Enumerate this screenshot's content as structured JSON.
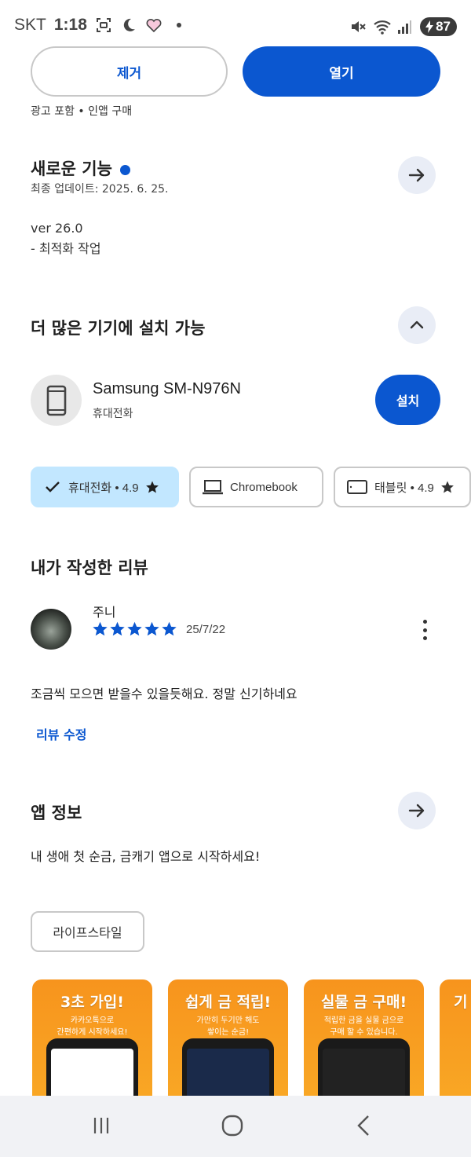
{
  "status_bar": {
    "carrier": "SKT",
    "time": "1:18",
    "battery": "87"
  },
  "actions": {
    "remove_label": "제거",
    "open_label": "열기"
  },
  "ads_note": "광고 포함 • 인앱 구매",
  "whats_new": {
    "title": "새로운 기능",
    "updated": "최종 업데이트: 2025. 6. 25.",
    "version": "ver 26.0",
    "notes": "- 최적화 작업"
  },
  "more_devices": {
    "title": "더 많은 기기에 설치 가능",
    "device_name": "Samsung SM-N976N",
    "device_type": "휴대전화",
    "install_label": "설치"
  },
  "device_chips": [
    {
      "label": "휴대전화 • 4.9",
      "selected": true
    },
    {
      "label": "Chromebook",
      "selected": false
    },
    {
      "label": "태블릿 • 4.9",
      "selected": false
    }
  ],
  "my_review": {
    "title": "내가 작성한 리뷰",
    "reviewer": "주니",
    "rating": 5,
    "date": "25/7/22",
    "text": "조금씩 모으면 받을수 있을듯해요. 정말 신기하네요",
    "edit_label": "리뷰 수정"
  },
  "app_info": {
    "title": "앱 정보",
    "description": "내 생애 첫 순금, 금캐기 앱으로 시작하세요!",
    "category_tag": "라이프스타일"
  },
  "screenshots": [
    {
      "heading": "3초 가입!",
      "sub1": "카카오톡으로",
      "sub2": "간편하게 시작하세요!"
    },
    {
      "heading": "쉽게 금 적립!",
      "sub1": "가만히 두기만 해도",
      "sub2": "쌓이는 순금!"
    },
    {
      "heading": "실물 금 구매!",
      "sub1": "적립한 금을 실물 금으로",
      "sub2": "구매 할 수 있습니다."
    },
    {
      "heading": "기",
      "sub1": "",
      "sub2": ""
    }
  ],
  "colors": {
    "accent": "#0b57d0",
    "chip_selected": "#c2e7ff",
    "star": "#0b57d0",
    "promo_orange": "#f7941d"
  }
}
